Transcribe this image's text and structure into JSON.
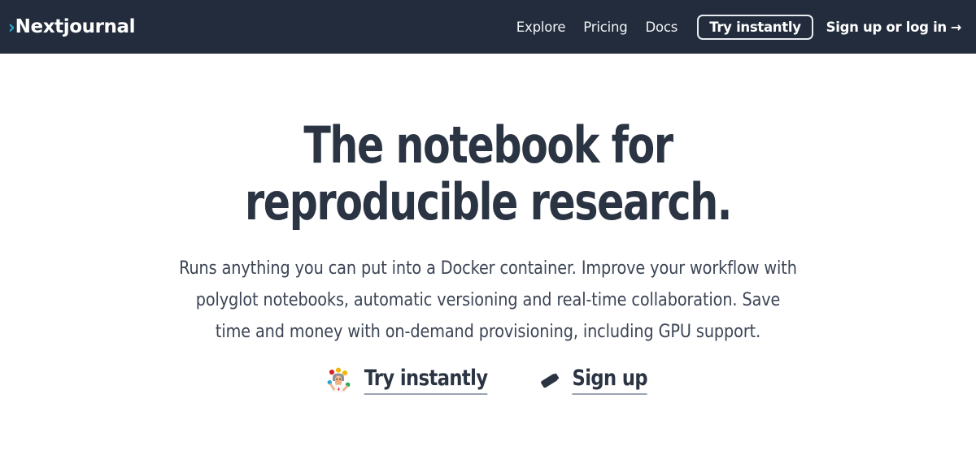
{
  "header": {
    "brand": {
      "chevron_icon": "chevron-right-icon",
      "chevron_glyph": "›",
      "name": "Nextjournal",
      "chevron_color": "#2ba6cb",
      "text_color": "#ffffff"
    },
    "background_color": "#222c3c",
    "nav_links": [
      {
        "label": "Explore"
      },
      {
        "label": "Pricing"
      },
      {
        "label": "Docs"
      }
    ],
    "try_button": {
      "label": "Try instantly"
    },
    "signup_link": {
      "label": "Sign up or log in",
      "arrow_icon": "arrow-right-icon",
      "arrow_glyph": "→"
    }
  },
  "hero": {
    "title_line_1": "The notebook for",
    "title_line_2": "reproducible research.",
    "title_color": "#2b3443",
    "subtitle": "Runs anything you can put into a Docker container. Improve your workflow with polyglot notebooks, automatic versioning and real-time collaboration. Save time and money with on-demand provisioning, including GPU support.",
    "subtitle_color": "#3c4555",
    "ctas": [
      {
        "icon": "woman-scientist-emoji",
        "emoji": "👩‍🔬",
        "label": "Try instantly"
      },
      {
        "icon": "pen-emoji",
        "emoji": "🖊",
        "label": "Sign up"
      }
    ]
  }
}
